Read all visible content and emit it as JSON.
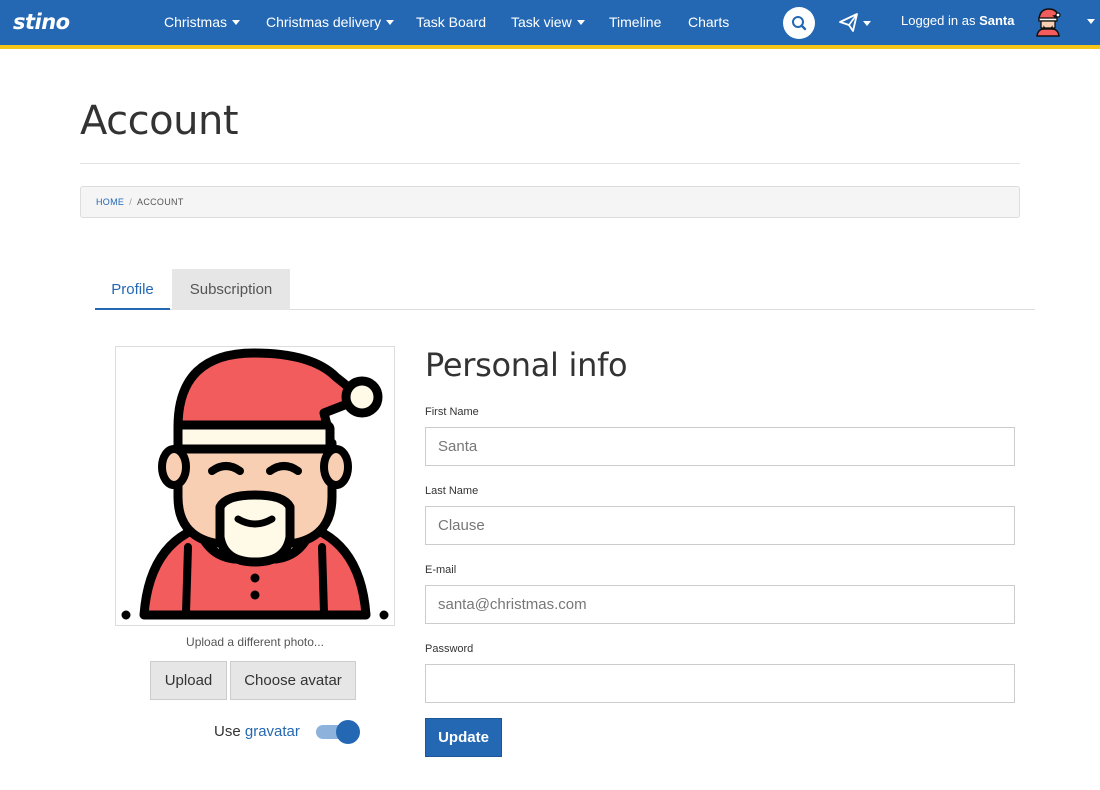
{
  "nav": {
    "brand": "stino",
    "items": [
      {
        "label": "Christmas",
        "dropdown": true
      },
      {
        "label": "Christmas delivery",
        "dropdown": true
      },
      {
        "label": "Task Board",
        "dropdown": false
      },
      {
        "label": "Task view",
        "dropdown": true
      },
      {
        "label": "Timeline",
        "dropdown": false
      },
      {
        "label": "Charts",
        "dropdown": false
      }
    ],
    "logged_prefix": "Logged in as",
    "user": "Santa",
    "colors": {
      "bar": "#2468b3",
      "stripe": "#f5c518"
    }
  },
  "page": {
    "title": "Account",
    "breadcrumb": {
      "home": "Home",
      "separator": "/",
      "current": "Account"
    }
  },
  "tabs": [
    {
      "label": "Profile",
      "active": true
    },
    {
      "label": "Subscription",
      "active": false
    }
  ],
  "avatar": {
    "upload_hint": "Upload a different photo...",
    "upload_label": "Upload",
    "choose_label": "Choose avatar",
    "gravatar_prefix": "Use",
    "gravatar_link": "gravatar",
    "gravatar_enabled": true
  },
  "form": {
    "title": "Personal info",
    "first_name": {
      "label": "First Name",
      "value": "Santa"
    },
    "last_name": {
      "label": "Last Name",
      "value": "Clause"
    },
    "email": {
      "label": "E-mail",
      "value": "santa@christmas.com"
    },
    "password": {
      "label": "Password",
      "value": ""
    },
    "submit_label": "Update"
  }
}
